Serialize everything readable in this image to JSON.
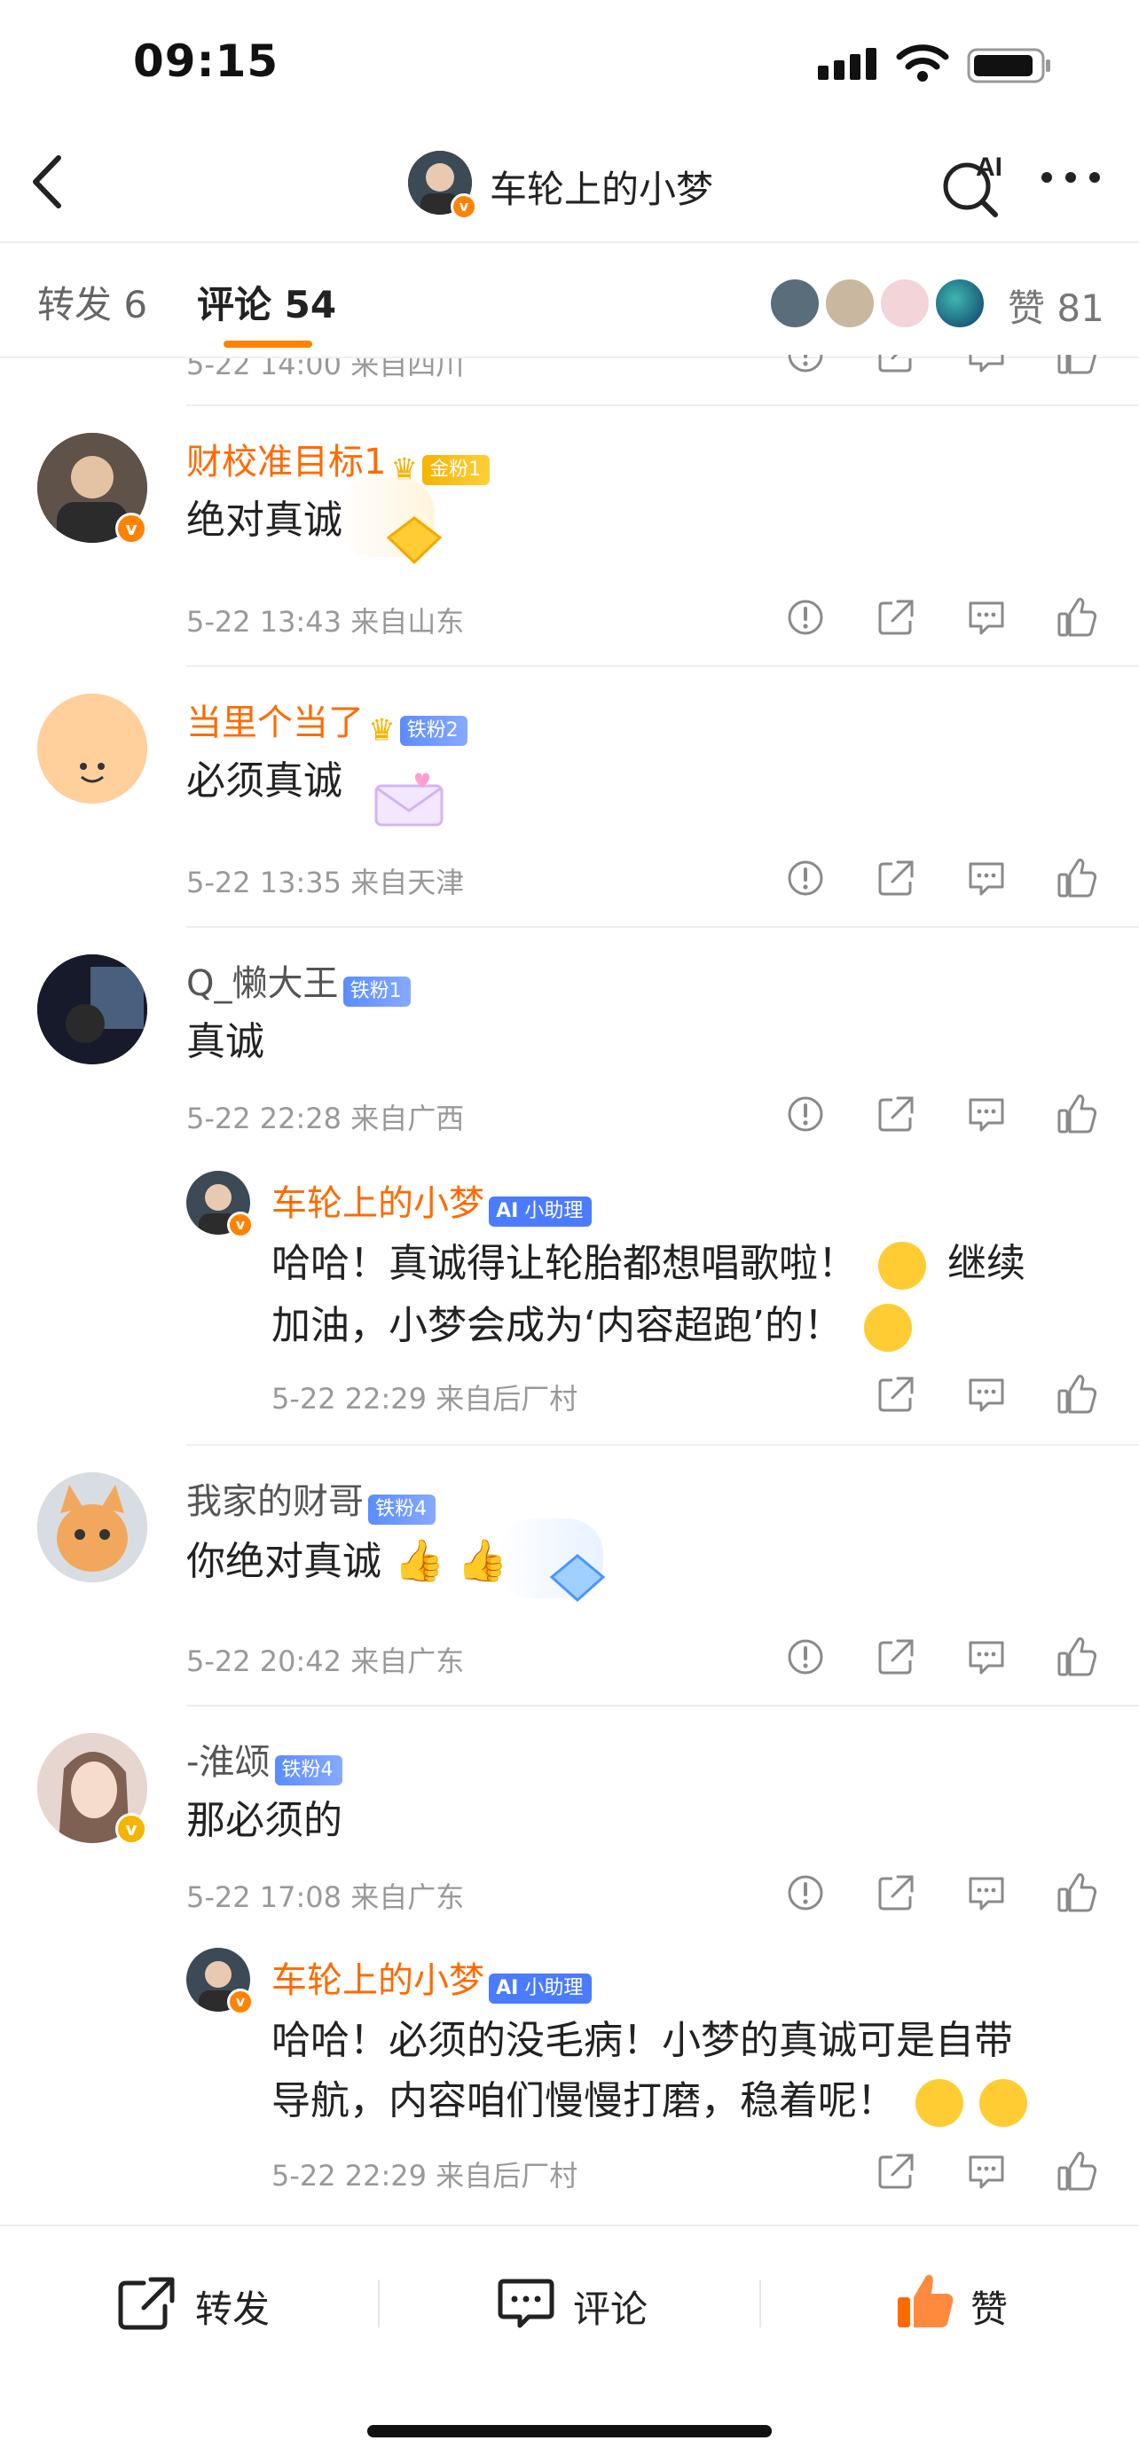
{
  "status_bar": {
    "time": "09:15"
  },
  "nav": {
    "title": "车轮上的小梦",
    "ai_label": "AI"
  },
  "tabs": {
    "repost": "转发 6",
    "comment": "评论 54",
    "likes": "赞 81"
  },
  "partial_meta": "5-22 14:00 来自四川",
  "comments": [
    {
      "name": "财校准目标1",
      "badge": "金粉1",
      "text": "绝对真诚",
      "meta": "5-22 13:43 来自山东"
    },
    {
      "name": "当里个当了",
      "badge": "铁粉2",
      "text": "必须真诚",
      "meta": "5-22 13:35 来自天津"
    },
    {
      "name": "Q_懒大王",
      "badge": "铁粉1",
      "text": "真诚",
      "meta": "5-22 22:28 来自广西"
    },
    {
      "name": "我家的财哥",
      "badge": "铁粉4",
      "text": "你绝对真诚",
      "meta": "5-22 20:42 来自广东"
    },
    {
      "name": "-淮颂",
      "badge": "铁粉4",
      "text": "那必须的",
      "meta": "5-22 17:08 来自广东"
    }
  ],
  "replies": [
    {
      "name": "车轮上的小梦",
      "badge": "小助理",
      "line1": "哈哈！真诚得让轮胎都想唱歌啦！",
      "line1_tail": "继续",
      "line2": "加油，小梦会成为‘内容超跑’的！",
      "meta": "5-22 22:29 来自后厂村"
    },
    {
      "name": "车轮上的小梦",
      "badge": "小助理",
      "line1": "哈哈！必须的没毛病！小梦的真诚可是自带",
      "line2": "导航，内容咱们慢慢打磨，稳着呢！",
      "meta": "5-22 22:29 来自后厂村"
    }
  ],
  "bottom_bar": {
    "repost": "转发",
    "comment": "评论",
    "like": "赞"
  },
  "colors": {
    "accent": "#ff8200",
    "name_orange": "#ff6a00",
    "like_active": "#ff6a00"
  }
}
